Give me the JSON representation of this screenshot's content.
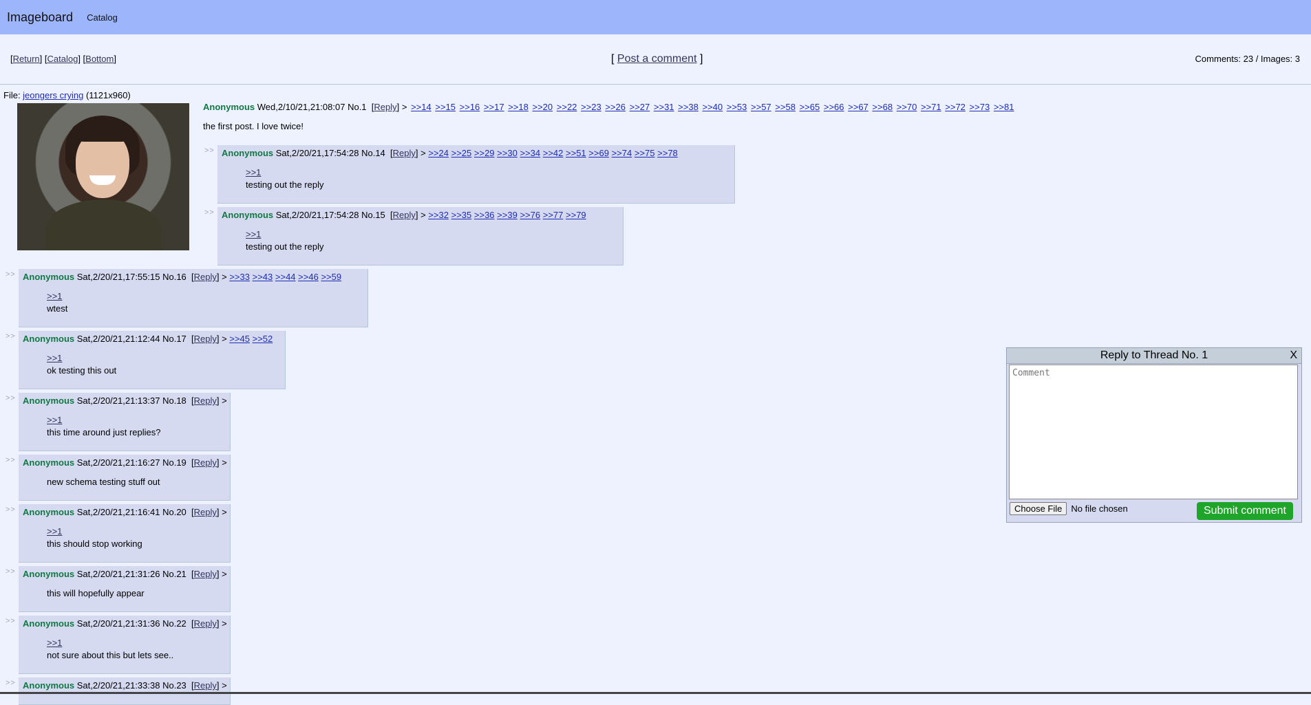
{
  "topbar": {
    "brand": "Imageboard",
    "catalog": "Catalog"
  },
  "nav": {
    "return_label": "Return",
    "catalog_label": "Catalog",
    "bottom_label": "Bottom",
    "post_comment": "Post a comment",
    "stats": "Comments: 23 / Images: 3"
  },
  "op": {
    "file_prefix": "File: ",
    "file_name": "jeongers crying",
    "file_dims": "(1121x960)",
    "name": "Anonymous",
    "date": "Wed,2/10/21,21:08:07",
    "no": "No.1",
    "reply_label": "Reply",
    "replies": [
      ">>14",
      ">>15",
      ">>16",
      ">>17",
      ">>18",
      ">>20",
      ">>22",
      ">>23",
      ">>26",
      ">>27",
      ">>31",
      ">>38",
      ">>40",
      ">>53",
      ">>57",
      ">>58",
      ">>65",
      ">>66",
      ">>67",
      ">>68",
      ">>70",
      ">>71",
      ">>72",
      ">>73",
      ">>81"
    ],
    "comment": "the first post. I love twice!"
  },
  "posts": [
    {
      "name": "Anonymous",
      "date": "Sat,2/20/21,17:54:28",
      "no": "No.14",
      "replies": [
        ">>24",
        ">>25",
        ">>29",
        ">>30",
        ">>34",
        ">>42",
        ">>51",
        ">>69",
        ">>74",
        ">>75",
        ">>78"
      ],
      "quote": ">>1",
      "text": "testing out the reply"
    },
    {
      "name": "Anonymous",
      "date": "Sat,2/20/21,17:54:28",
      "no": "No.15",
      "replies": [
        ">>32",
        ">>35",
        ">>36",
        ">>39",
        ">>76",
        ">>77",
        ">>79"
      ],
      "quote": ">>1",
      "text": "testing out the reply"
    },
    {
      "name": "Anonymous",
      "date": "Sat,2/20/21,17:55:15",
      "no": "No.16",
      "replies": [
        ">>33",
        ">>43",
        ">>44",
        ">>46",
        ">>59"
      ],
      "quote": ">>1",
      "text": "wtest"
    },
    {
      "name": "Anonymous",
      "date": "Sat,2/20/21,21:12:44",
      "no": "No.17",
      "replies": [
        ">>45",
        ">>52"
      ],
      "quote": ">>1",
      "text": "ok testing this out"
    },
    {
      "name": "Anonymous",
      "date": "Sat,2/20/21,21:13:37",
      "no": "No.18",
      "replies": [],
      "quote": ">>1",
      "text": "this time around just replies?"
    },
    {
      "name": "Anonymous",
      "date": "Sat,2/20/21,21:16:27",
      "no": "No.19",
      "replies": [],
      "quote": "",
      "text": "new schema testing stuff out"
    },
    {
      "name": "Anonymous",
      "date": "Sat,2/20/21,21:16:41",
      "no": "No.20",
      "replies": [],
      "quote": ">>1",
      "text": "this should stop working"
    },
    {
      "name": "Anonymous",
      "date": "Sat,2/20/21,21:31:26",
      "no": "No.21",
      "replies": [],
      "quote": "",
      "text": "this will hopefully appear"
    },
    {
      "name": "Anonymous",
      "date": "Sat,2/20/21,21:31:36",
      "no": "No.22",
      "replies": [],
      "quote": ">>1",
      "text": "not sure about this but lets see.."
    },
    {
      "name": "Anonymous",
      "date": "Sat,2/20/21,21:33:38",
      "no": "No.23",
      "replies": [],
      "quote": "",
      "text": ""
    }
  ],
  "common": {
    "reply_label": "Reply",
    "arrows": ">>"
  },
  "quick_reply": {
    "title": "Reply to Thread No. 1",
    "close": "X",
    "placeholder": "Comment",
    "choose_file": "Choose File",
    "no_file": "No file chosen",
    "submit": "Submit comment"
  }
}
